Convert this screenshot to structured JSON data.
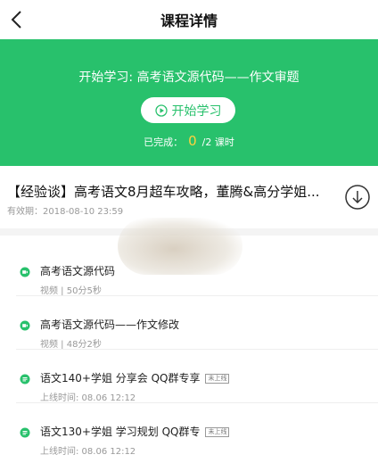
{
  "nav": {
    "title": "课程详情",
    "back_icon": "chevron-left-icon"
  },
  "hero": {
    "bg_color": "#28c16c",
    "title": "开始学习: 高考语文源代码——作文审题",
    "start_label": "开始学习",
    "done_prefix": "已完成：",
    "done_count": "0",
    "done_suffix": "/2 课时"
  },
  "course": {
    "title": "【经验谈】高考语文8月超车攻略，董腾&高分学姐...",
    "validity": "有效期：2018-08-10 23:59",
    "download_icon": "download-icon"
  },
  "lessons": [
    {
      "icon": "video-icon",
      "name": "高考语文源代码",
      "meta": "视频 | 50分5秒",
      "badge": ""
    },
    {
      "icon": "video-icon",
      "name": "高考语文源代码——作文修改",
      "meta": "视频 | 48分2秒",
      "badge": ""
    },
    {
      "icon": "live-icon",
      "name": "语文140+学姐 分享会 QQ群专享",
      "meta": "上线时间:  08.06 12:12",
      "badge": "未上线"
    },
    {
      "icon": "live-icon",
      "name": "语文130+学姐 学习规划 QQ群专",
      "meta": "上线时间:  08.06 12:12",
      "badge": "未上线"
    }
  ]
}
